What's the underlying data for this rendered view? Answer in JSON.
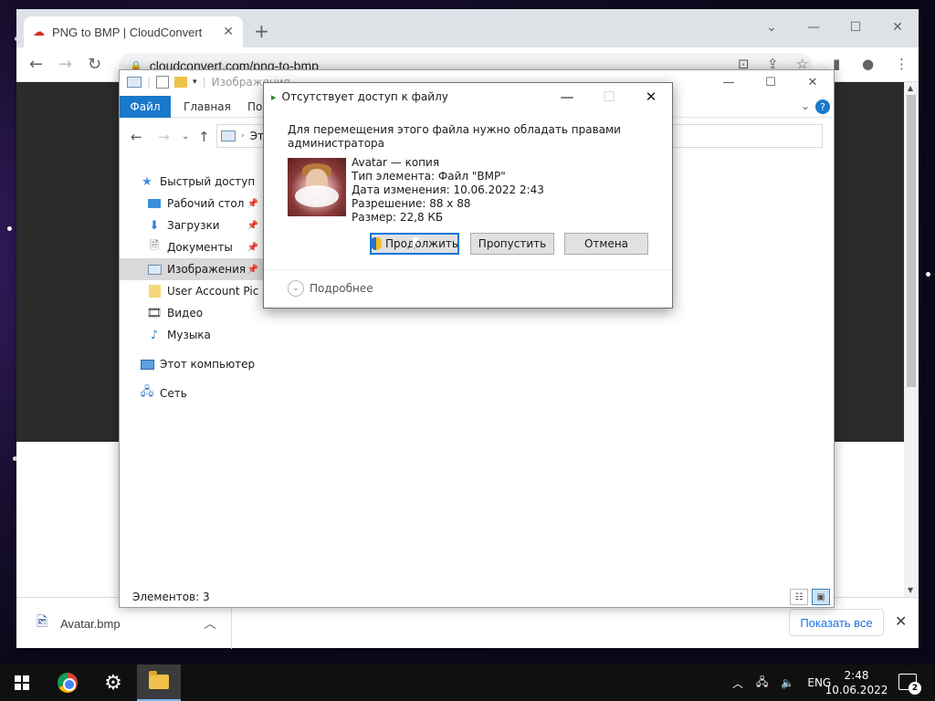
{
  "browser": {
    "tab_title": "PNG to BMP | CloudConvert",
    "new_tab_icon": "plus-icon",
    "url": "cloudconvert.com/png-to-bmp",
    "download": {
      "file_name": "Avatar.bmp",
      "show_all_label": "Показать все"
    }
  },
  "explorer": {
    "title": "Изображения",
    "ribbon": {
      "file_label": "Файл",
      "home_label": "Главная",
      "share_label": "Под",
      "help_label": "?"
    },
    "address_crumb": "Эт",
    "nav": {
      "quick_access": "Быстрый доступ",
      "desktop": "Рабочий стол",
      "downloads": "Загрузки",
      "documents": "Документы",
      "pictures": "Изображения",
      "user_account": "User Account Pic",
      "video": "Видео",
      "music": "Музыка",
      "this_pc": "Этот компьютер",
      "network": "Сеть"
    },
    "status": "Элементов: 3"
  },
  "dialog": {
    "title": "Отсутствует доступ к файлу",
    "message": "Для перемещения этого файла нужно обладать правами администратора",
    "file": {
      "name": "Avatar — копия",
      "type": "Тип элемента: Файл \"BMP\"",
      "modified": "Дата изменения: 10.06.2022 2:43",
      "resolution": "Разрешение: 88 x 88",
      "size": "Размер: 22,8 КБ"
    },
    "continue_label": "Продолжить",
    "skip_label": "Пропустить",
    "cancel_label": "Отмена",
    "details_label": "Подробнее"
  },
  "taskbar": {
    "language": "ENG",
    "time": "2:48",
    "date": "10.06.2022",
    "notification_count": "2"
  }
}
